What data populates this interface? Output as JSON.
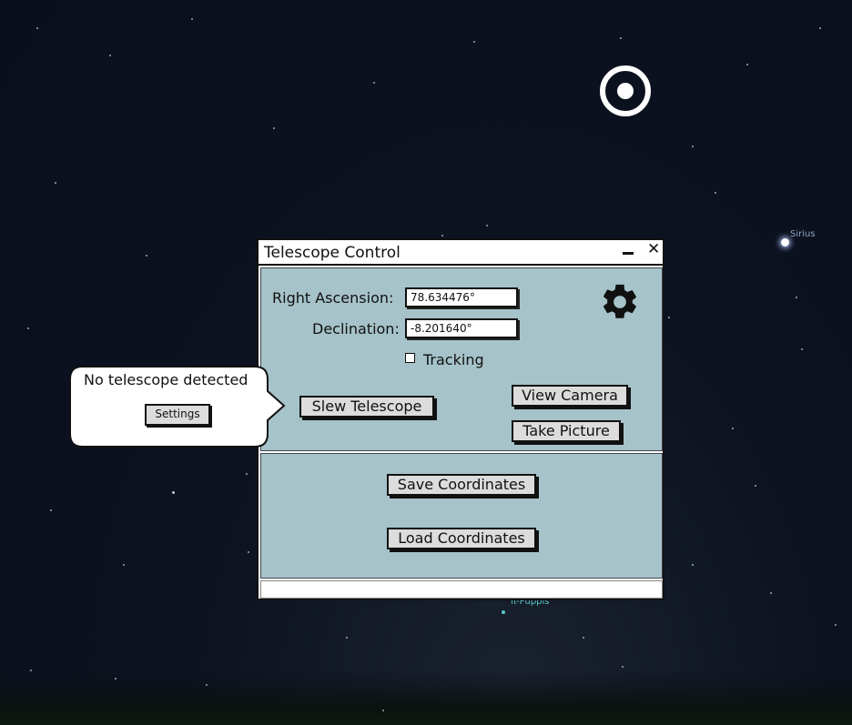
{
  "sky": {
    "sirius_label": "Sirius",
    "puppis_label": "π-Puppis"
  },
  "window": {
    "title": "Telescope Control",
    "minimize_label": "",
    "close_label": "✕",
    "ra_label": "Right Ascension:",
    "ra_value": "78.634476°",
    "dec_label": "Declination:",
    "dec_value": "-8.201640°",
    "tracking_label": "Tracking",
    "tracking_checked": false,
    "slew_button": "Slew Telescope",
    "view_camera_button": "View Camera",
    "take_picture_button": "Take Picture",
    "save_coords_button": "Save Coordinates",
    "load_coords_button": "Load Coordinates",
    "status_text": ""
  },
  "callout": {
    "message": "No telescope detected",
    "settings_button": "Settings"
  },
  "icons": {
    "settings": "gear-icon",
    "target": "target-reticle-icon",
    "minimize": "minimize-icon",
    "close": "close-icon"
  }
}
